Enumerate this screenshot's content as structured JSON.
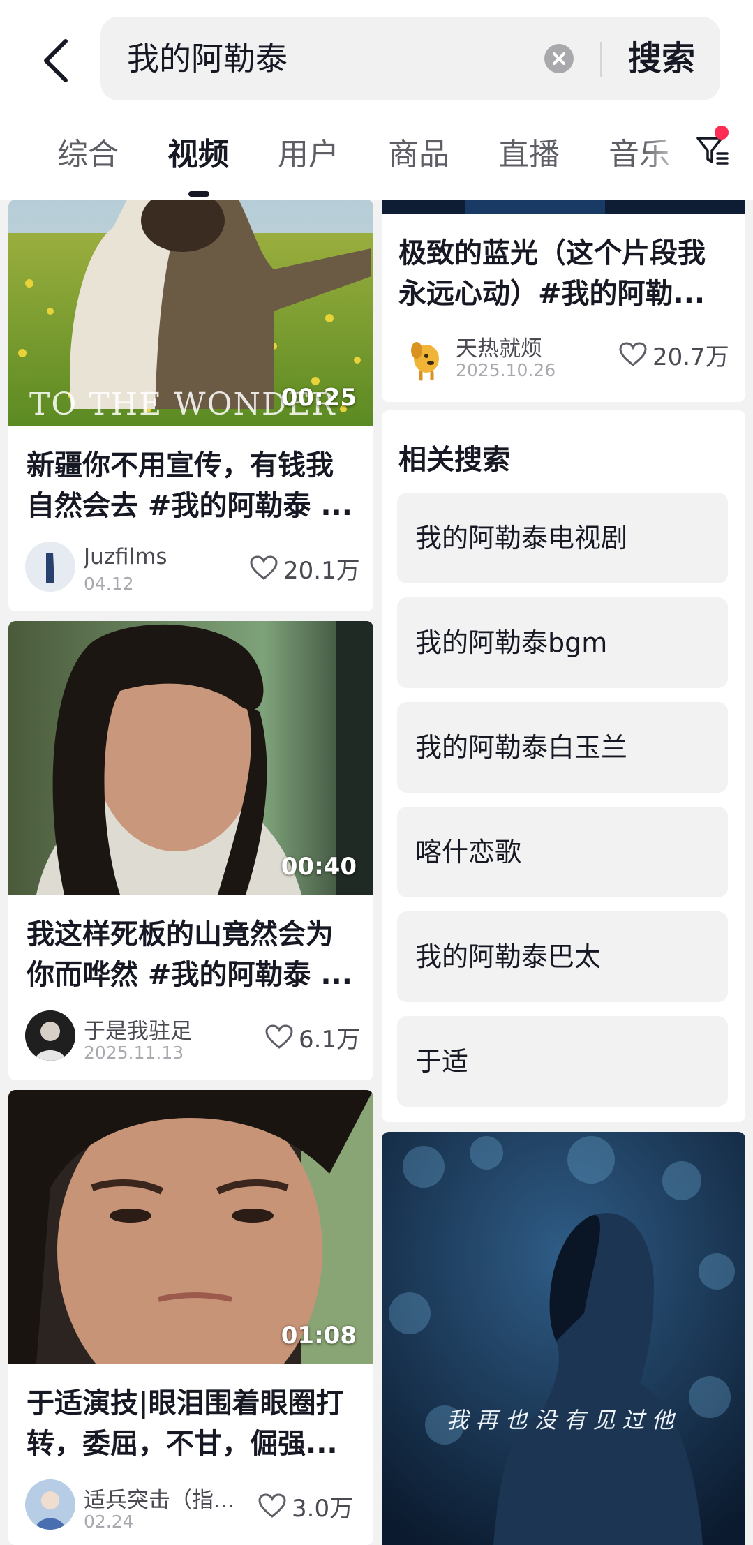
{
  "search": {
    "query": "我的阿勒泰",
    "submit_label": "搜索"
  },
  "tabs": [
    {
      "label": "综合"
    },
    {
      "label": "视频",
      "active": true
    },
    {
      "label": "用户"
    },
    {
      "label": "商品"
    },
    {
      "label": "直播"
    },
    {
      "label": "音乐"
    }
  ],
  "left_videos": [
    {
      "duration": "00:25",
      "overlay_text": "TO THE WONDER",
      "title": "新疆你不用宣传，有钱我自然会去 #我的阿勒泰 ...",
      "author": "Juzfilms",
      "date": "04.12",
      "likes": "20.1万"
    },
    {
      "duration": "00:40",
      "title": "我这样死板的山竟然会为你而哗然 #我的阿勒泰 ...",
      "author": "于是我驻足",
      "date": "2025.11.13",
      "likes": "6.1万"
    },
    {
      "duration": "01:08",
      "title": "于适演技|眼泪围着眼圈打转，委屈，不甘，倔强...",
      "author": "适兵突击（指...",
      "date": "02.24",
      "likes": "3.0万"
    }
  ],
  "right_videos": [
    {
      "title": "极致的蓝光（这个片段我永远心动）#我的阿勒...",
      "author": "天热就烦",
      "date": "2025.10.26",
      "likes": "20.7万"
    },
    {
      "subtitle": "我再也没有见过他"
    }
  ],
  "related": {
    "title": "相关搜索",
    "items": [
      "我的阿勒泰电视剧",
      "我的阿勒泰bgm",
      "我的阿勒泰白玉兰",
      "喀什恋歌",
      "我的阿勒泰巴太",
      "于适"
    ]
  },
  "colors": {
    "accent": "#fe2c55",
    "text_primary": "#161823",
    "text_secondary": "#5d5e66",
    "page_background": "#f2f2f2"
  }
}
